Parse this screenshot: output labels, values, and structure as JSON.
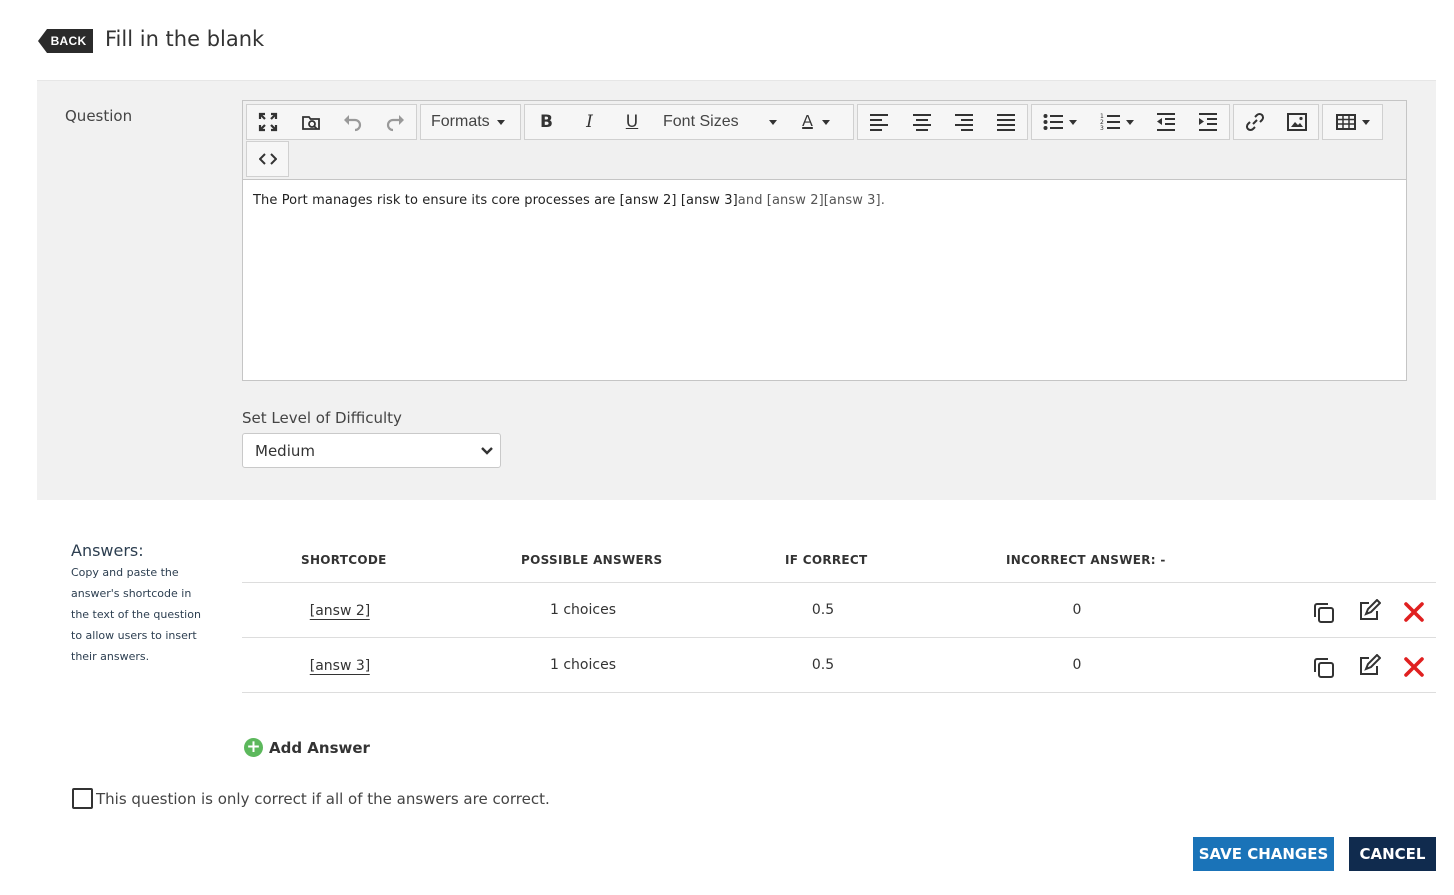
{
  "header": {
    "back_label": "BACK",
    "title": "Fill in the blank"
  },
  "question": {
    "label": "Question",
    "toolbar": {
      "formats_label": "Formats",
      "font_sizes_label": "Font Sizes",
      "icons": [
        "fullscreen-icon",
        "preview-icon",
        "undo-icon",
        "redo-icon",
        "bold-icon",
        "italic-icon",
        "underline-icon",
        "text-color-icon",
        "align-left-icon",
        "align-center-icon",
        "align-right-icon",
        "justify-icon",
        "bullet-list-icon",
        "numbered-list-icon",
        "outdent-icon",
        "indent-icon",
        "link-icon",
        "image-icon",
        "table-icon",
        "source-code-icon"
      ]
    },
    "text_part1": "The Port manages risk to ensure its core processes are [answ 2] [answ 3]",
    "text_part2": "and [answ 2][answ 3].",
    "difficulty_label": "Set Level of Difficulty",
    "difficulty_value": "Medium"
  },
  "answers": {
    "title": "Answers:",
    "help": "Copy and paste the answer's shortcode in the text of the question to allow users to insert their answers.",
    "columns": {
      "shortcode": "SHORTCODE",
      "possible": "POSSIBLE ANSWERS",
      "if_correct": "IF CORRECT",
      "incorrect": "INCORRECT ANSWER: -"
    },
    "rows": [
      {
        "shortcode": "[answ 2]",
        "possible": "1 choices",
        "if_correct": "0.5",
        "incorrect": "0"
      },
      {
        "shortcode": "[answ 3]",
        "possible": "1 choices",
        "if_correct": "0.5",
        "incorrect": "0"
      }
    ],
    "add_label": "Add Answer"
  },
  "all_correct_label": "This question is only correct if all of the answers are correct.",
  "buttons": {
    "save": "SAVE CHANGES",
    "cancel": "CANCEL"
  },
  "colors": {
    "save": "#1a73b8",
    "cancel": "#102b4e",
    "delete": "#e02020",
    "add": "#5cb85c"
  }
}
